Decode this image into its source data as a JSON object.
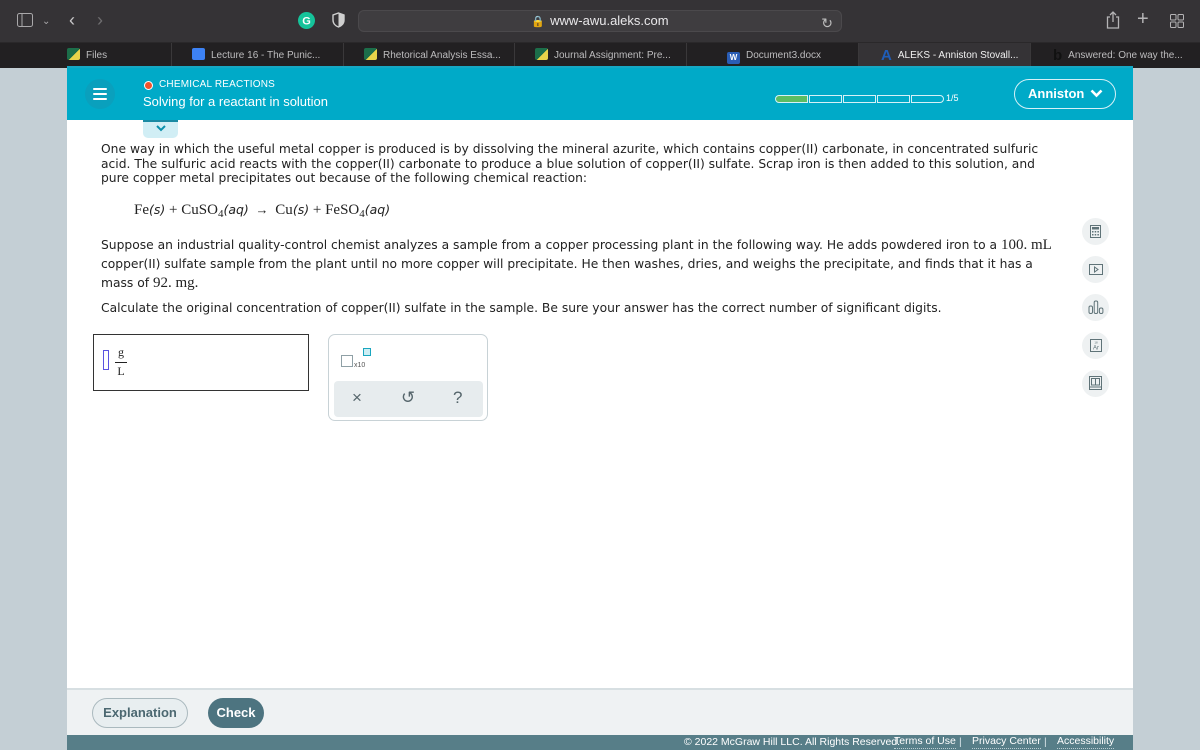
{
  "browser": {
    "url": "www-awu.aleks.com",
    "tabs": [
      {
        "label": "Files",
        "favicon": "canvas",
        "active": false
      },
      {
        "label": "Lecture 16 - The Punic...",
        "favicon": "google-docs",
        "active": false
      },
      {
        "label": "Rhetorical Analysis Essa...",
        "favicon": "canvas",
        "active": false
      },
      {
        "label": "Journal Assignment: Pre...",
        "favicon": "canvas",
        "active": false
      },
      {
        "label": "Document3.docx",
        "favicon": "word",
        "active": false
      },
      {
        "label": "ALEKS - Anniston Stovall...",
        "favicon": "aleks",
        "active": true
      },
      {
        "label": "Answered: One way the...",
        "favicon": "bartleby",
        "active": false
      }
    ],
    "favicon_letters": {
      "word": "W",
      "aleks": "A",
      "bartleby": "b"
    }
  },
  "header": {
    "topic": "CHEMICAL REACTIONS",
    "subtopic": "Solving for a reactant in solution",
    "progress": {
      "completed": 1,
      "total": 5,
      "label": "1/5"
    },
    "user_button": "Anniston",
    "accent_color": "#00aac8",
    "status_dot_color": "#f0532c"
  },
  "problem": {
    "intro": "One way in which the useful metal copper is produced is by dissolving the mineral azurite, which contains copper(II) carbonate, in concentrated sulfuric acid. The sulfuric acid reacts with the copper(II) carbonate to produce a blue solution of copper(II) sulfate. Scrap iron is then added to this solution, and pure copper metal precipitates out because of the following chemical reaction:",
    "equation": {
      "r1": "Fe",
      "r1_state": "(s)",
      "plus": "+",
      "r2": "CuSO",
      "r2_sub": "4",
      "r2_state": "(aq)",
      "arrow": "→",
      "p1": "Cu",
      "p1_state": "(s)",
      "p2": "FeSO",
      "p2_sub": "4",
      "p2_state": "(aq)"
    },
    "scenario_part1": "Suppose an industrial quality-control chemist analyzes a sample from a copper processing plant in the following way. He adds powdered iron to a ",
    "volume": "100. mL",
    "scenario_part2": " copper(II) sulfate sample from the plant until no more copper will precipitate. He then washes, dries, and weighs the precipitate, and finds that it has a mass of ",
    "mass": "92. mg",
    "scenario_end": ".",
    "question": "Calculate the original concentration of copper(II) sulfate in the sample. Be sure your answer has the correct number of significant digits."
  },
  "answer": {
    "value": "",
    "unit_numerator": "g",
    "unit_denominator": "L"
  },
  "palette": {
    "sci_notation_label": "x10",
    "clear": "×",
    "undo": "↺",
    "help": "?"
  },
  "side_tools": [
    {
      "name": "calculator",
      "glyph": "▦"
    },
    {
      "name": "video",
      "glyph": "▷"
    },
    {
      "name": "data-chart",
      "glyph": "ıl"
    },
    {
      "name": "periodic-table",
      "glyph": "Ar"
    },
    {
      "name": "ebook",
      "glyph": "📖"
    }
  ],
  "footer": {
    "explanation": "Explanation",
    "check": "Check",
    "copyright": "© 2022 McGraw Hill LLC. All Rights Reserved.",
    "links": [
      "Terms of Use",
      "Privacy Center",
      "Accessibility"
    ],
    "separator": "|"
  }
}
